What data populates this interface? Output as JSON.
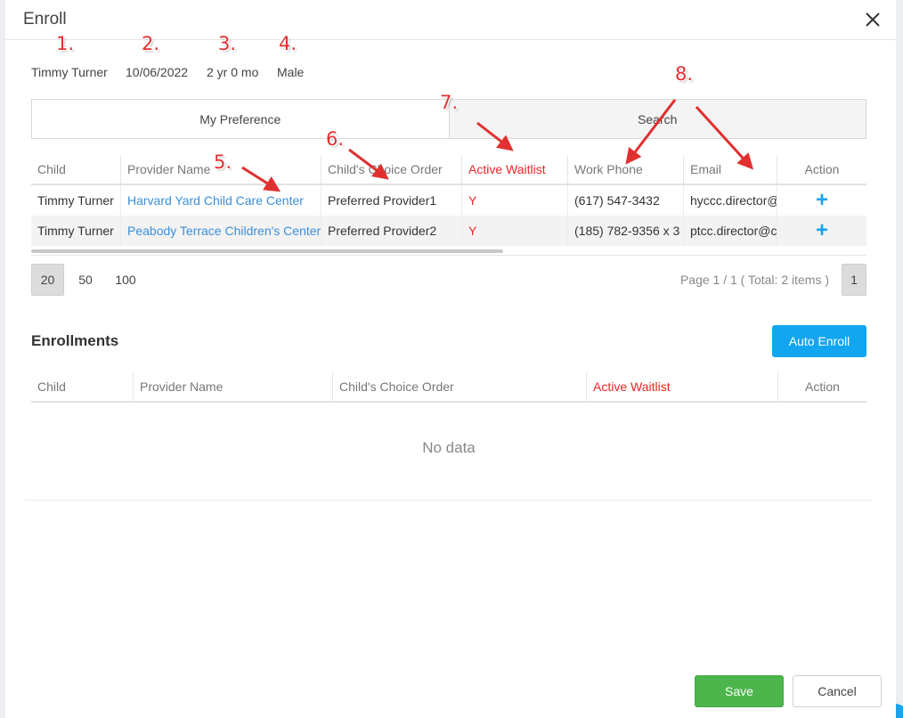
{
  "modal": {
    "title": "Enroll"
  },
  "child_info": {
    "name": "Timmy Turner",
    "dob": "10/06/2022",
    "age": "2 yr 0 mo",
    "gender": "Male"
  },
  "annotations": [
    "1.",
    "2.",
    "3.",
    "4.",
    "5.",
    "6.",
    "7.",
    "8."
  ],
  "tabs": [
    {
      "label": "My Preference",
      "active": true
    },
    {
      "label": "Search",
      "active": false
    }
  ],
  "preference_table": {
    "headers": {
      "child": "Child",
      "provider": "Provider Name",
      "choice": "Child's Choice Order",
      "waitlist": "Active Waitlist",
      "phone": "Work Phone",
      "email": "Email",
      "action": "Action"
    },
    "rows": [
      {
        "child": "Timmy Turner",
        "provider": "Harvard Yard Child Care Center",
        "choice": "Preferred Provider1",
        "waitlist": "Y",
        "phone": "(617) 547-3432",
        "email": "hyccc.director@",
        "action": "+"
      },
      {
        "child": "Timmy Turner",
        "provider": "Peabody Terrace Children's Center",
        "choice": "Preferred Provider2",
        "waitlist": "Y",
        "phone": "(185) 782-9356 x 3",
        "email": "ptcc.director@c",
        "action": "+"
      }
    ]
  },
  "pager": {
    "sizes": [
      "20",
      "50",
      "100"
    ],
    "selected_size": "20",
    "info": "Page 1 / 1 ( Total: 2 items )",
    "page": "1"
  },
  "enrollments": {
    "title": "Enrollments",
    "auto_enroll_label": "Auto Enroll",
    "headers": {
      "child": "Child",
      "provider": "Provider Name",
      "choice": "Child's Choice Order",
      "waitlist": "Active Waitlist",
      "action": "Action"
    },
    "empty_text": "No data"
  },
  "footer": {
    "save_label": "Save",
    "cancel_label": "Cancel"
  },
  "colors": {
    "accent": "#11a6ef",
    "save": "#4cb64c",
    "waitlist": "#ee2525",
    "link": "#3b8fd9",
    "annotation": "#e03030"
  }
}
